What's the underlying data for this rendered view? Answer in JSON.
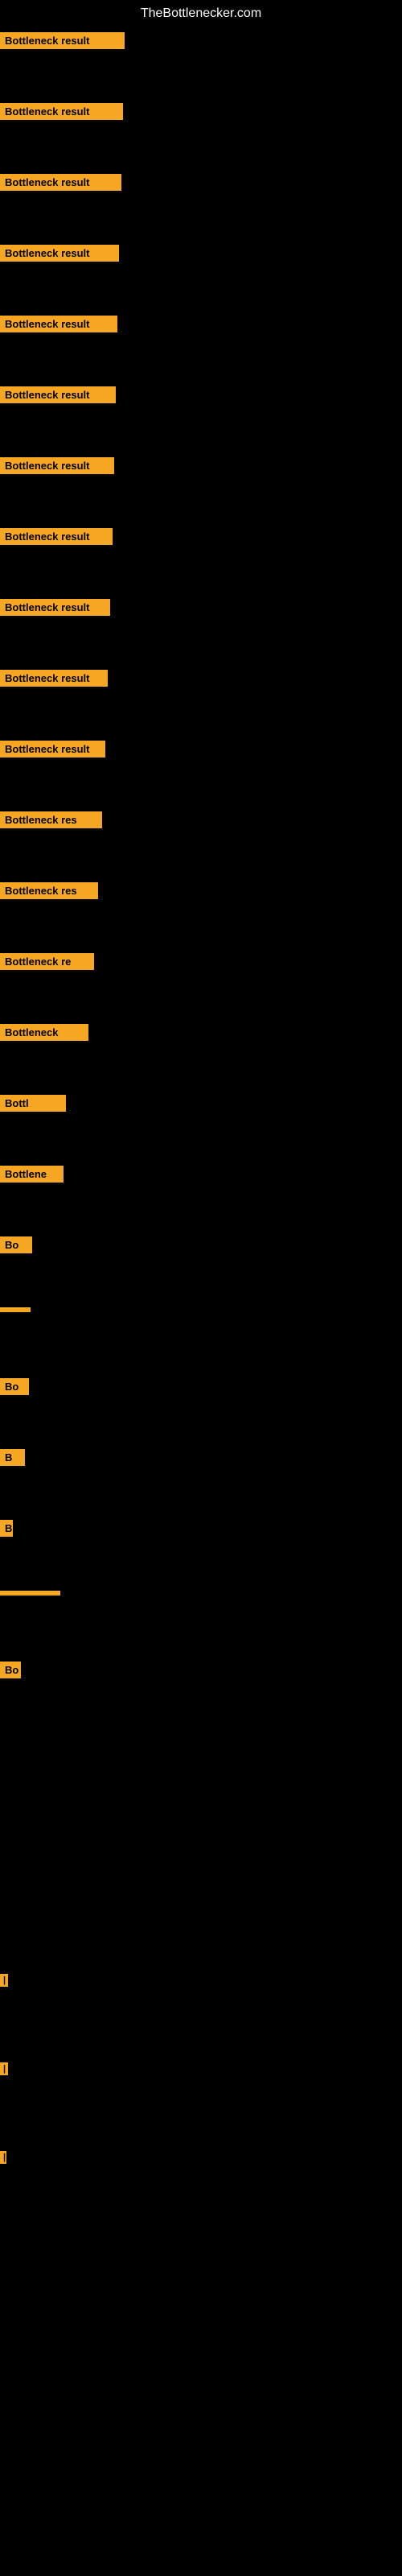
{
  "site": {
    "title": "TheBottlenecker.com"
  },
  "rows": [
    {
      "id": "row-1",
      "label": "Bottleneck result"
    },
    {
      "id": "row-2",
      "label": "Bottleneck result"
    },
    {
      "id": "row-3",
      "label": "Bottleneck result"
    },
    {
      "id": "row-4",
      "label": "Bottleneck result"
    },
    {
      "id": "row-5",
      "label": "Bottleneck result"
    },
    {
      "id": "row-6",
      "label": "Bottleneck result"
    },
    {
      "id": "row-7",
      "label": "Bottleneck result"
    },
    {
      "id": "row-8",
      "label": "Bottleneck result"
    },
    {
      "id": "row-9",
      "label": "Bottleneck result"
    },
    {
      "id": "row-10",
      "label": "Bottleneck result"
    },
    {
      "id": "row-11",
      "label": "Bottleneck result"
    },
    {
      "id": "row-12",
      "label": "Bottleneck res"
    },
    {
      "id": "row-13",
      "label": "Bottleneck res"
    },
    {
      "id": "row-14",
      "label": "Bottleneck re"
    },
    {
      "id": "row-15",
      "label": "Bottleneck"
    },
    {
      "id": "row-16",
      "label": "Bottl"
    },
    {
      "id": "row-17",
      "label": "Bottlene"
    },
    {
      "id": "row-18",
      "label": "Bo"
    },
    {
      "id": "row-19",
      "label": ""
    },
    {
      "id": "row-20",
      "label": "Bo"
    },
    {
      "id": "row-21",
      "label": "B"
    },
    {
      "id": "row-22",
      "label": "Bottle"
    },
    {
      "id": "row-23",
      "label": ""
    },
    {
      "id": "row-24",
      "label": "Bo"
    }
  ],
  "small_rows": [
    {
      "id": "small-row-1",
      "label": "|"
    },
    {
      "id": "small-row-2",
      "label": "|"
    },
    {
      "id": "small-row-3",
      "label": "|"
    }
  ]
}
